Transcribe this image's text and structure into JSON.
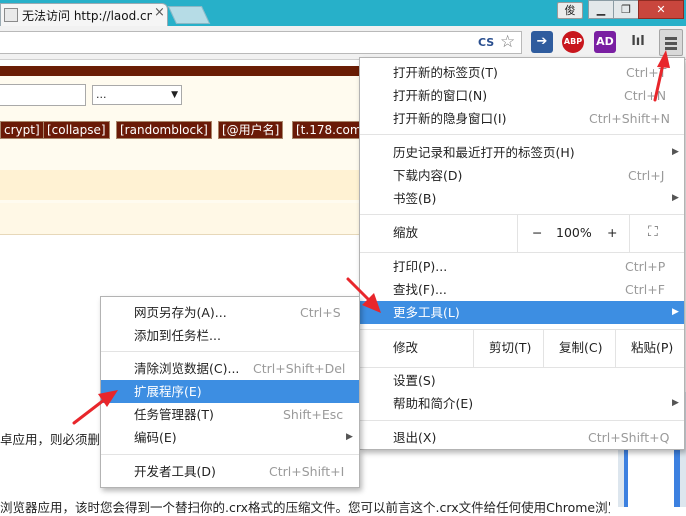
{
  "tab": {
    "title": "无法访问 http://laod.cn/",
    "close": "×"
  },
  "profile_label": "俊",
  "window_controls": {
    "minimize": "▁",
    "restore": "❐",
    "close": "✕"
  },
  "toolbar": {
    "cs_label": "CS",
    "star": "☆",
    "ext1": "➔",
    "ext2": "ABP",
    "ext3": "AD",
    "ext4": "lıl"
  },
  "page": {
    "select_value": "...",
    "tags": [
      "crypt]",
      "[collapse]",
      "[randomblock]",
      "[@用户名]",
      "[t.178.com"
    ],
    "text_a": "卓应用，则必须删除",
    "text_b": "浏览器应用，该时您会得到一个替扫你的.crx格式的压缩文件。您可以前言这个.crx文件给任何使用Chrome浏览器"
  },
  "chrome_menu": {
    "items": [
      {
        "label": "打开新的标签页(T)",
        "shortcut": "Ctrl+T"
      },
      {
        "label": "打开新的窗口(N)",
        "shortcut": "Ctrl+N"
      },
      {
        "label": "打开新的隐身窗口(I)",
        "shortcut": "Ctrl+Shift+N"
      },
      {
        "label": "历史记录和最近打开的标签页(H)",
        "submenu": "▶"
      },
      {
        "label": "下载内容(D)",
        "shortcut": "Ctrl+J"
      },
      {
        "label": "书签(B)",
        "submenu": "▶"
      },
      {
        "label": "打印(P)...",
        "shortcut": "Ctrl+P"
      },
      {
        "label": "查找(F)...",
        "shortcut": "Ctrl+F"
      },
      {
        "label": "更多工具(L)",
        "submenu": "▶"
      },
      {
        "label": "设置(S)"
      },
      {
        "label": "帮助和简介(E)",
        "submenu": "▶"
      },
      {
        "label": "退出(X)",
        "shortcut": "Ctrl+Shift+Q"
      }
    ],
    "zoom": {
      "label": "缩放",
      "minus": "−",
      "value": "100%",
      "plus": "+",
      "fullscreen": "⛶"
    },
    "edit": {
      "label": "修改",
      "cut": "剪切(T)",
      "copy": "复制(C)",
      "paste": "粘贴(P)"
    }
  },
  "submenu": {
    "items": [
      {
        "label": "网页另存为(A)...",
        "shortcut": "Ctrl+S"
      },
      {
        "label": "添加到任务栏..."
      },
      {
        "label": "清除浏览数据(C)...",
        "shortcut": "Ctrl+Shift+Del"
      },
      {
        "label": "扩展程序(E)"
      },
      {
        "label": "任务管理器(T)",
        "shortcut": "Shift+Esc"
      },
      {
        "label": "编码(E)",
        "submenu": "▶"
      },
      {
        "label": "开发者工具(D)",
        "shortcut": "Ctrl+Shift+I"
      }
    ]
  },
  "colors": {
    "highlight": "#3d8ee2",
    "annotation_arrow": "#e8262b",
    "title_bar": "#27b0c9"
  }
}
